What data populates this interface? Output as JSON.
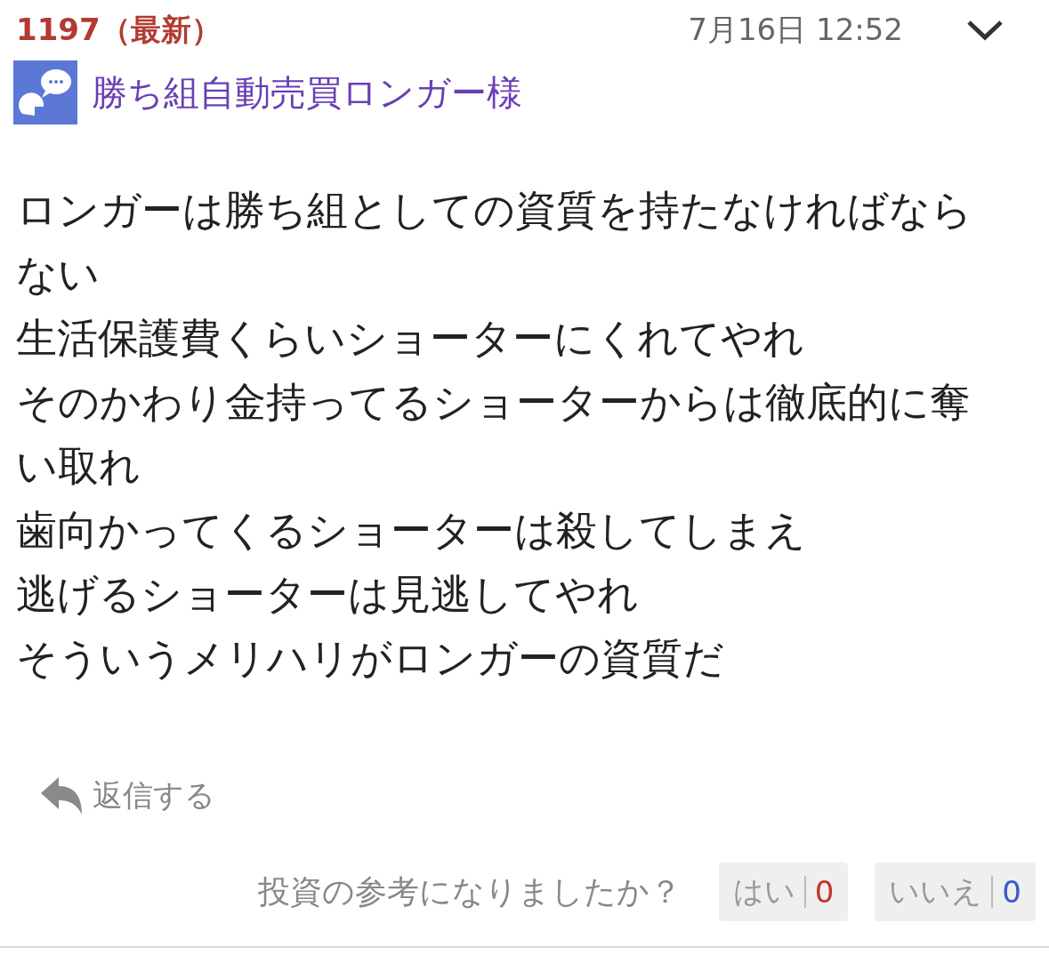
{
  "post": {
    "number": "1197（最新）",
    "date": "7月16日 12:52",
    "author": "勝ち組自動売買ロンガー様",
    "lines": [
      "ロンガーは勝ち組としての資質を持たなければならない",
      "生活保護費くらいショーターにくれてやれ",
      "そのかわり金持ってるショーターからは徹底的に奪い取れ",
      "歯向かってくるショーターは殺してしまえ",
      "逃げるショーターは見逃してやれ",
      "そういうメリハリがロンガーの資質だ"
    ],
    "reply": "返信する"
  },
  "feedback": {
    "question": "投資の参考になりましたか？",
    "buttons": [
      {
        "label": "はい",
        "count": "0",
        "color": "#c0392b"
      },
      {
        "label": "いいえ",
        "count": "0",
        "color": "#3a5bc7"
      }
    ]
  }
}
